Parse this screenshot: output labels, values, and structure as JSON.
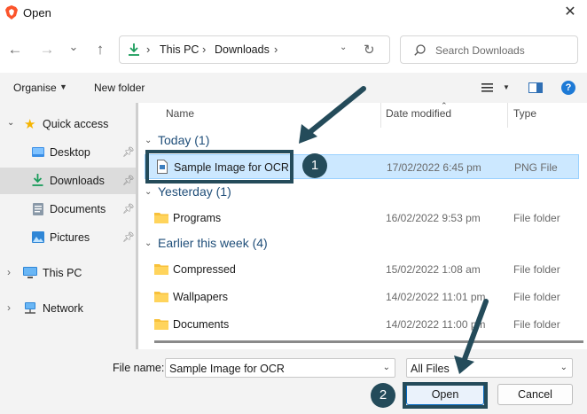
{
  "window": {
    "title": "Open",
    "close_glyph": "✕"
  },
  "nav": {
    "back": "←",
    "forward": "→",
    "recent": "⌄",
    "up": "↑",
    "refresh": "↻"
  },
  "address": {
    "crumbs": [
      "This PC",
      "Downloads"
    ],
    "sep": "›"
  },
  "search": {
    "placeholder": "Search Downloads"
  },
  "toolbar": {
    "organise": "Organise",
    "new_folder": "New folder"
  },
  "sidebar": {
    "quick_access": "Quick access",
    "items": [
      {
        "label": "Desktop"
      },
      {
        "label": "Downloads"
      },
      {
        "label": "Documents"
      },
      {
        "label": "Pictures"
      }
    ],
    "this_pc": "This PC",
    "network": "Network"
  },
  "columns": {
    "name": "Name",
    "date": "Date modified",
    "type": "Type"
  },
  "groups": [
    {
      "label": "Today (1)"
    },
    {
      "label": "Yesterday (1)"
    },
    {
      "label": "Earlier this week (4)"
    }
  ],
  "files": [
    {
      "name": "Sample Image for OCR",
      "date": "17/02/2022 6:45 pm",
      "type": "PNG File"
    },
    {
      "name": "Programs",
      "date": "16/02/2022 9:53 pm",
      "type": "File folder"
    },
    {
      "name": "Compressed",
      "date": "15/02/2022 1:08 am",
      "type": "File folder"
    },
    {
      "name": "Wallpapers",
      "date": "14/02/2022 11:01 pm",
      "type": "File folder"
    },
    {
      "name": "Documents",
      "date": "14/02/2022 11:00 pm",
      "type": "File folder"
    }
  ],
  "bottom": {
    "filename_label": "File name:",
    "filename_value": "Sample Image for OCR",
    "filter": "All Files",
    "open": "Open",
    "cancel": "Cancel"
  },
  "annotations": {
    "step1": "1",
    "step2": "2"
  },
  "colors": {
    "accent": "#244b5a",
    "selection": "#cce8ff",
    "folder": "#f8c13a",
    "group_text": "#1f4e79"
  }
}
